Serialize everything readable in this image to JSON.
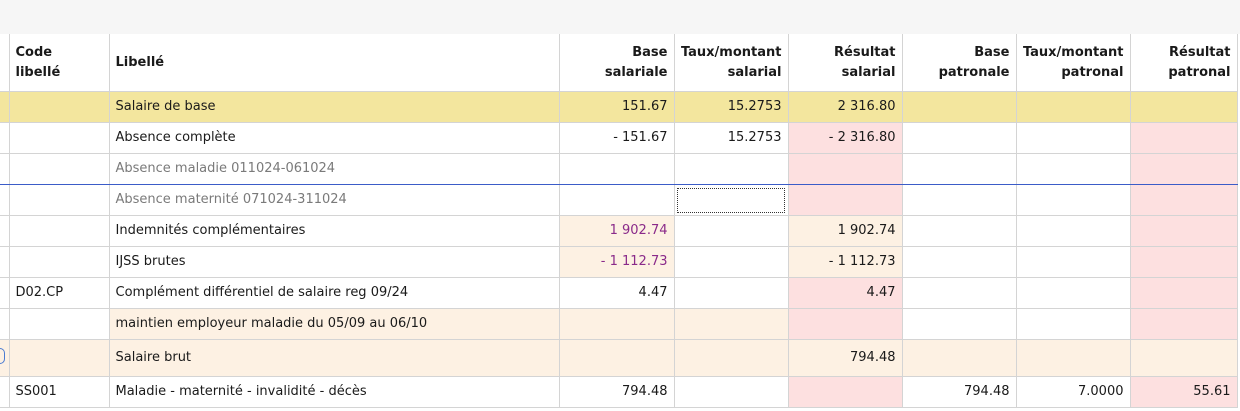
{
  "columns": {
    "code": "Code\nlibellé",
    "libelle": "Libellé",
    "base_sal": "Base\nsalariale",
    "taux_sal": "Taux/montant\nsalarial",
    "res_sal": "Résultat\nsalarial",
    "base_pat": "Base\npatronale",
    "taux_pat": "Taux/montant\npatronal",
    "res_pat": "Résultat\npatronal"
  },
  "rows": [
    {
      "code": "",
      "libelle": "Salaire de base",
      "base_sal": "151.67",
      "taux_sal": "15.2753",
      "res_sal": "2 316.80",
      "base_pat": "",
      "taux_pat": "",
      "res_pat": ""
    },
    {
      "code": "",
      "libelle": "Absence complète",
      "base_sal": "- 151.67",
      "taux_sal": "15.2753",
      "res_sal": "- 2 316.80",
      "base_pat": "",
      "taux_pat": "",
      "res_pat": ""
    },
    {
      "code": "",
      "libelle": "Absence maladie 011024-061024",
      "base_sal": "",
      "taux_sal": "",
      "res_sal": "",
      "base_pat": "",
      "taux_pat": "",
      "res_pat": ""
    },
    {
      "code": "",
      "libelle": "Absence maternité 071024-311024",
      "base_sal": "",
      "taux_sal": "",
      "res_sal": "",
      "base_pat": "",
      "taux_pat": "",
      "res_pat": ""
    },
    {
      "code": "",
      "libelle": "Indemnités complémentaires",
      "base_sal": "1 902.74",
      "taux_sal": "",
      "res_sal": "1 902.74",
      "base_pat": "",
      "taux_pat": "",
      "res_pat": ""
    },
    {
      "code": "",
      "libelle": "IJSS brutes",
      "base_sal": "- 1 112.73",
      "taux_sal": "",
      "res_sal": "- 1 112.73",
      "base_pat": "",
      "taux_pat": "",
      "res_pat": ""
    },
    {
      "code": "D02.CP",
      "libelle": "Complément différentiel de salaire reg 09/24",
      "base_sal": "4.47",
      "taux_sal": "",
      "res_sal": "4.47",
      "base_pat": "",
      "taux_pat": "",
      "res_pat": ""
    },
    {
      "code": "",
      "libelle": "maintien employeur maladie du 05/09 au 06/10",
      "base_sal": "",
      "taux_sal": "",
      "res_sal": "",
      "base_pat": "",
      "taux_pat": "",
      "res_pat": ""
    },
    {
      "code": "",
      "libelle": "Salaire brut",
      "base_sal": "",
      "taux_sal": "",
      "res_sal": "794.48",
      "base_pat": "",
      "taux_pat": "",
      "res_pat": ""
    },
    {
      "code": "SS001",
      "libelle": "Maladie - maternité - invalidité - décès",
      "base_sal": "794.48",
      "taux_sal": "",
      "res_sal": "",
      "base_pat": "794.48",
      "taux_pat": "7.0000",
      "res_pat": "55.61"
    }
  ],
  "colors": {
    "highlight_row": "#f3e69e",
    "peach_cell": "#fdf1e3",
    "pink_cell": "#fde0e0",
    "violet_text": "#8a2a8a",
    "selection_line": "#3b5cc8"
  }
}
